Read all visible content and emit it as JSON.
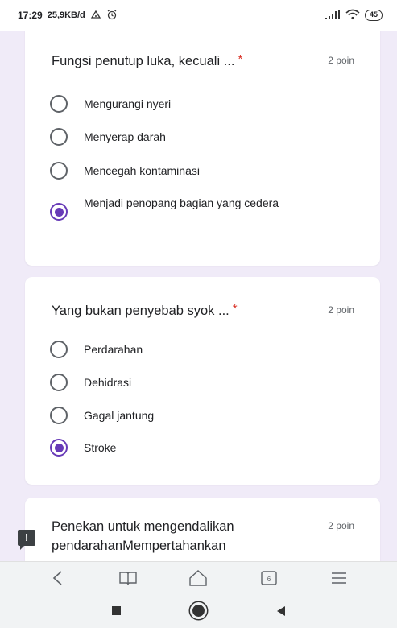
{
  "status_bar": {
    "time": "17:29",
    "speed": "25,9KB/d",
    "battery": "45"
  },
  "questions": [
    {
      "title": "Fungsi penutup luka, kecuali ...",
      "required_mark": "*",
      "points": "2 poin",
      "options": [
        {
          "label": "Mengurangi nyeri",
          "selected": false
        },
        {
          "label": "Menyerap darah",
          "selected": false
        },
        {
          "label": "Mencegah kontaminasi",
          "selected": false
        },
        {
          "label": "Menjadi penopang bagian yang cedera",
          "selected": true
        }
      ]
    },
    {
      "title": "Yang bukan penyebab syok ...",
      "required_mark": "*",
      "points": "2 poin",
      "options": [
        {
          "label": "Perdarahan",
          "selected": false
        },
        {
          "label": "Dehidrasi",
          "selected": false
        },
        {
          "label": "Gagal jantung",
          "selected": false
        },
        {
          "label": "Stroke",
          "selected": true
        }
      ]
    },
    {
      "title": "Penekan untuk mengendalikan pendarahanMempertahankan",
      "points": "2 poin"
    }
  ],
  "feedback_icon": "!",
  "browser_nav": [
    "back-icon",
    "bookmarks-icon",
    "home-icon",
    "tabs-icon",
    "menu-icon"
  ],
  "browser_tabs_count": "6",
  "accent_color": "#673ab7",
  "background_color": "#f0ebf8"
}
